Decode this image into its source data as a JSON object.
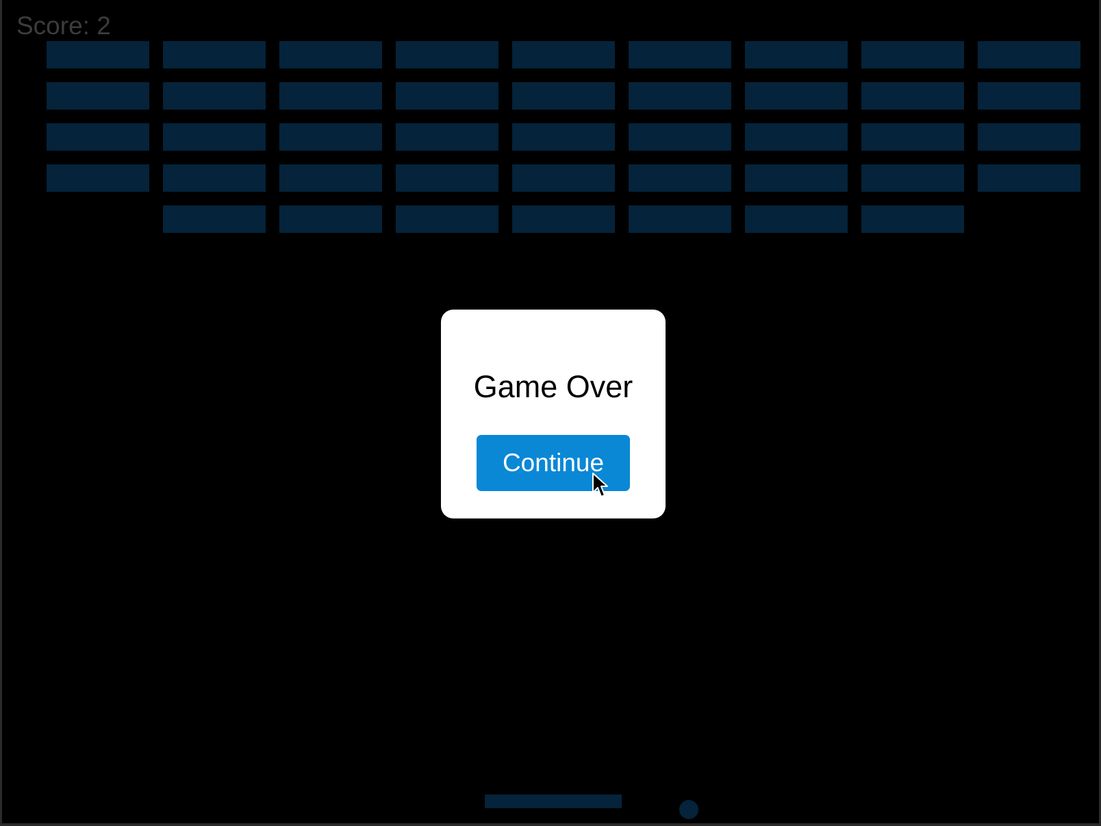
{
  "score": {
    "label": "Score: ",
    "value": "2"
  },
  "modal": {
    "title": "Game Over",
    "button_label": "Continue"
  },
  "game_state": {
    "brick_rows": [
      [
        1,
        1,
        1,
        1,
        1,
        1,
        1,
        1,
        1
      ],
      [
        1,
        1,
        1,
        1,
        1,
        1,
        1,
        1,
        1
      ],
      [
        1,
        1,
        1,
        1,
        1,
        1,
        1,
        1,
        1
      ],
      [
        1,
        1,
        1,
        1,
        1,
        1,
        1,
        1,
        1
      ],
      [
        0,
        1,
        1,
        1,
        1,
        1,
        1,
        1,
        0
      ]
    ]
  },
  "colors": {
    "background": "#000000",
    "brick": "#05233a",
    "paddle": "#05233a",
    "ball": "#05233a",
    "button": "#0a88d6",
    "score_text": "#3c3c3c"
  },
  "icons": {
    "cursor": "arrow-cursor-icon"
  }
}
